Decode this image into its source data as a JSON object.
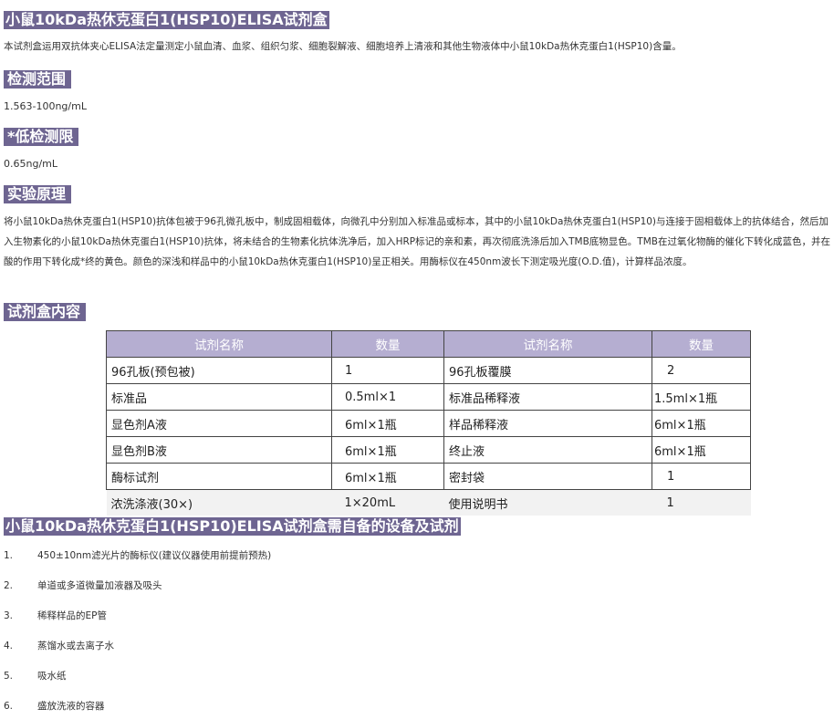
{
  "title": "小鼠10kDa热休克蛋白1(HSP10)ELISA试剂盒",
  "intro": "本试剂盒运用双抗体夹心ELISA法定量测定小鼠血清、血浆、组织匀浆、细胞裂解液、细胞培养上清液和其他生物液体中小鼠10kDa热休克蛋白1(HSP10)含量。",
  "sections": {
    "range": {
      "title": "检测范围",
      "text": "1.563-100ng/mL"
    },
    "limit": {
      "title": "*低检测限",
      "text": "0.65ng/mL"
    },
    "principle": {
      "title": "实验原理",
      "text": "将小鼠10kDa热休克蛋白1(HSP10)抗体包被于96孔微孔板中，制成固相载体，向微孔中分别加入标准品或标本，其中的小鼠10kDa热休克蛋白1(HSP10)与连接于固相载体上的抗体结合，然后加入生物素化的小鼠10kDa热休克蛋白1(HSP10)抗体，将未结合的生物素化抗体洗净后，加入HRP标记的亲和素，再次彻底洗涤后加入TMB底物显色。TMB在过氧化物酶的催化下转化成蓝色，并在酸的作用下转化成*终的黄色。颜色的深浅和样品中的小鼠10kDa热休克蛋白1(HSP10)呈正相关。用酶标仪在450nm波长下测定吸光度(O.D.值)，计算样品浓度。"
    },
    "kit": {
      "title": "试剂盒内容",
      "headers": [
        "试剂名称",
        "数量",
        "试剂名称",
        "数量"
      ],
      "rows": [
        [
          "96孔板(预包被)",
          "1",
          "96孔板覆膜",
          "2"
        ],
        [
          "标准品",
          "0.5ml×1",
          "标准品稀释液",
          "1.5ml×1瓶"
        ],
        [
          "显色剂A液",
          "6ml×1瓶",
          "样品稀释液",
          "6ml×1瓶"
        ],
        [
          "显色剂B液",
          "6ml×1瓶",
          "终止液",
          "6ml×1瓶"
        ],
        [
          "酶标试剂",
          "6ml×1瓶",
          "密封袋",
          "1"
        ],
        [
          "浓洗涤液(30×)",
          "1×20mL",
          "使用说明书",
          "1"
        ]
      ]
    },
    "equipment": {
      "title": "小鼠10kDa热休克蛋白1(HSP10)ELISA试剂盒需自备的设备及试剂",
      "items": [
        {
          "num": "1.",
          "text": "450±10nm滤光片的酶标仪(建议仪器使用前提前预热)"
        },
        {
          "num": "2.",
          "text": "单道或多道微量加液器及吸头"
        },
        {
          "num": "3.",
          "text": "稀释样品的EP管"
        },
        {
          "num": "4.",
          "text": "蒸馏水或去离子水"
        },
        {
          "num": "5.",
          "text": "吸水纸"
        },
        {
          "num": "6.",
          "text": "盛放洗液的容器"
        }
      ]
    }
  },
  "colors": {
    "header_bg": "#6e6591",
    "table_head_bg": "#b5aed1"
  }
}
